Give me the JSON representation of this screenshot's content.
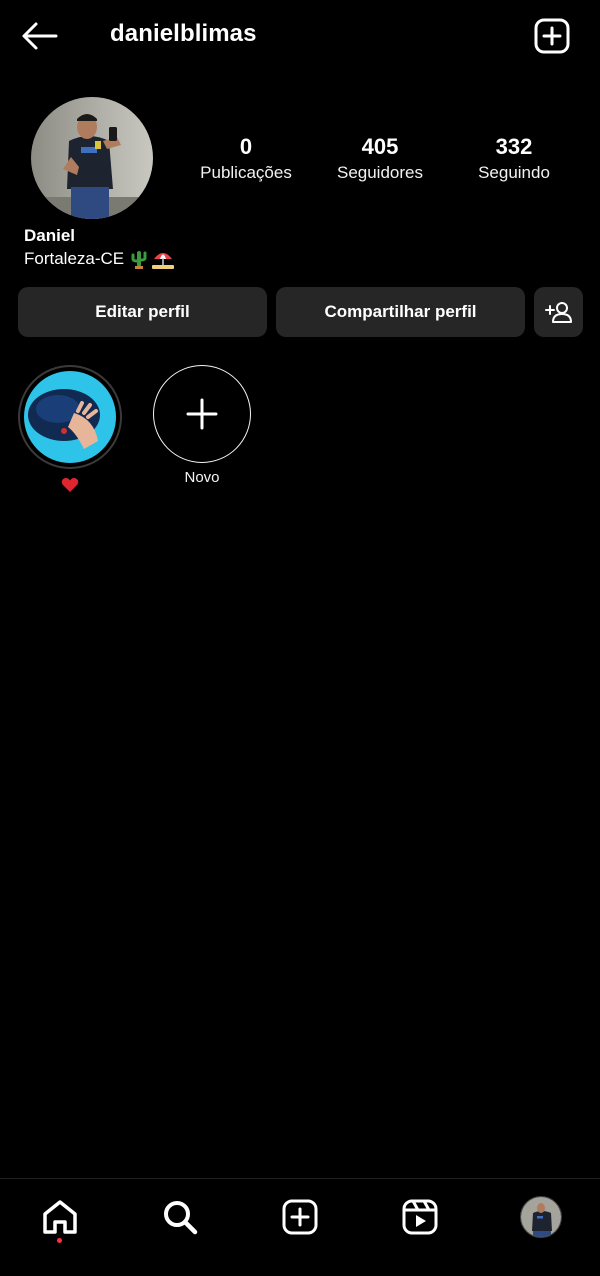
{
  "header": {
    "username": "danielblimas",
    "back_icon": "arrow-left-icon",
    "new_post_icon": "plus-square-icon"
  },
  "profile": {
    "avatar_icon": "profile-photo",
    "stats": [
      {
        "value": "0",
        "label": "Publicações"
      },
      {
        "value": "405",
        "label": "Seguidores"
      },
      {
        "value": "332",
        "label": "Seguindo"
      }
    ],
    "name": "Daniel",
    "location": "Fortaleza-CE",
    "location_emojis": [
      "cactus-emoji",
      "beach-umbrella-emoji"
    ]
  },
  "actions": {
    "edit_label": "Editar perfil",
    "share_label": "Compartilhar perfil",
    "discover_icon": "add-person-icon"
  },
  "highlights": [
    {
      "label_icon": "red-heart-emoji",
      "cover": "highlight-photo"
    },
    {
      "label": "Novo",
      "icon": "plus-icon"
    }
  ],
  "bottom_nav": {
    "items": [
      "home-icon",
      "search-icon",
      "create-icon",
      "reels-icon",
      "profile-avatar"
    ],
    "notification_dot_color": "#ff3040"
  },
  "colors": {
    "background": "#000000",
    "button_bg": "#262626",
    "text": "#ffffff"
  }
}
